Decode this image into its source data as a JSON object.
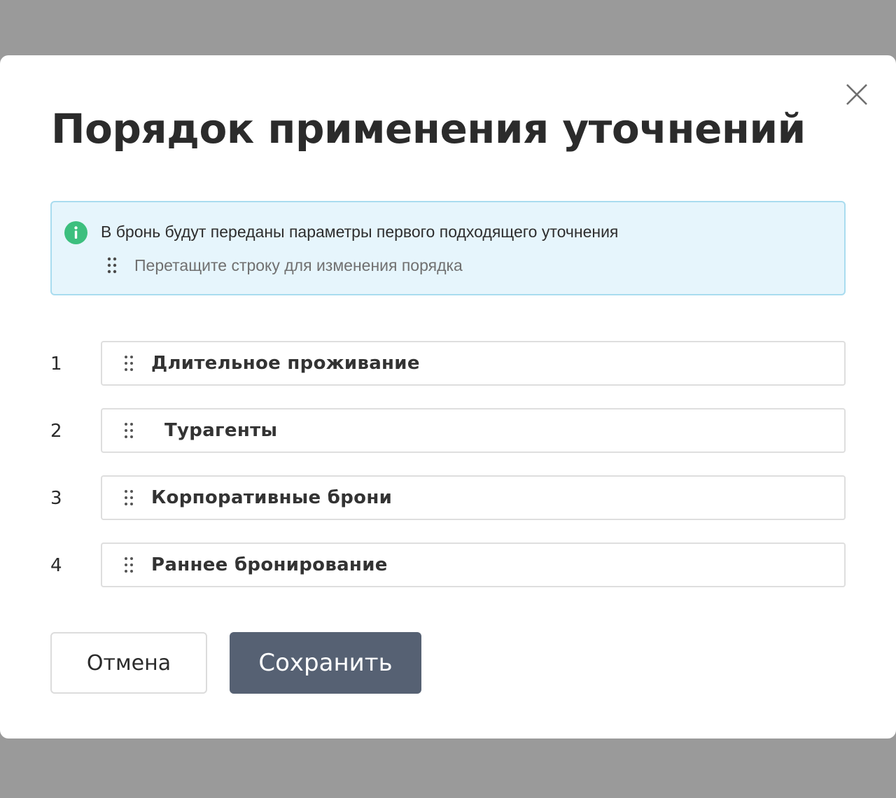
{
  "dialog": {
    "title": "Порядок применения уточнений",
    "close_icon": "close-icon"
  },
  "info": {
    "icon": "info-icon",
    "icon_color": "#3cbf7e",
    "message": "В бронь будут переданы параметры первого подходящего уточнения",
    "hint_icon": "drag-handle-icon",
    "hint": "Перетащите строку для изменения порядка",
    "background": "#e6f5fc",
    "border": "#a9dcef"
  },
  "rows": [
    {
      "number": "1",
      "label": "Длительное проживание"
    },
    {
      "number": "2",
      "label": "Турагенты"
    },
    {
      "number": "3",
      "label": "Корпоративные брони"
    },
    {
      "number": "4",
      "label": "Раннее бронирование"
    }
  ],
  "actions": {
    "cancel_label": "Отмена",
    "save_label": "Сохранить",
    "save_color": "#566173"
  }
}
